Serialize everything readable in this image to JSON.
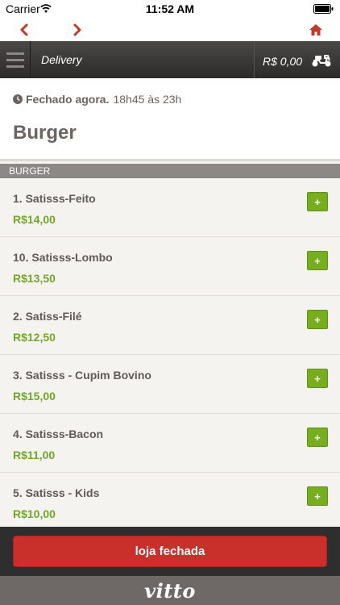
{
  "status_bar": {
    "carrier": "Carrier",
    "time": "11:52 AM"
  },
  "browser_bar": {
    "back_icon": "chevron-left-icon",
    "forward_icon": "chevron-right-icon",
    "home_icon": "home-icon"
  },
  "header": {
    "title": "Delivery",
    "cart_total": "R$ 0,00",
    "delivery_icon": "scooter-icon"
  },
  "store": {
    "status_label": "Fechado agora.",
    "hours": "18h45 às 23h",
    "category_title": "Burger"
  },
  "section": {
    "title": "BURGER"
  },
  "products": [
    {
      "name": "1. Satisss-Feito",
      "price": "R$14,00"
    },
    {
      "name": "10. Satisss-Lombo",
      "price": "R$13,50"
    },
    {
      "name": "2. Satiss-Filé",
      "price": "R$12,50"
    },
    {
      "name": "3. Satisss - Cupim Bovino",
      "price": "R$15,00"
    },
    {
      "name": "4. Satisss-Bacon",
      "price": "R$11,00"
    },
    {
      "name": "5. Satisss - Kids",
      "price": "R$10,00"
    }
  ],
  "add_label": "+",
  "bottom": {
    "closed_button_label": "loja fechada"
  },
  "footer": {
    "logo": "vitto"
  },
  "colors": {
    "accent_green": "#76ae1e",
    "price_green": "#72a628",
    "closed_red": "#c9302c",
    "nav_red": "#c0392b",
    "header_dark": "#2c2b2a"
  }
}
